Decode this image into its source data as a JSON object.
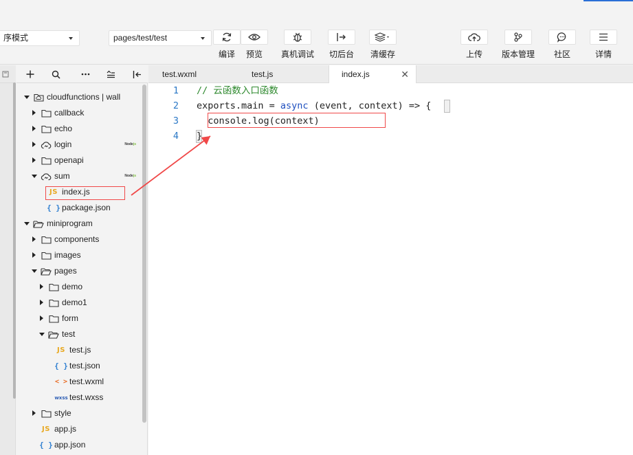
{
  "toolbar": {
    "mode_select": "序模式",
    "page_select": "pages/test/test",
    "buttons": [
      {
        "label": "编译",
        "icon": "refresh-icon"
      },
      {
        "label": "预览",
        "icon": "eye-icon"
      },
      {
        "label": "真机调试",
        "icon": "bug-icon"
      },
      {
        "label": "切后台",
        "icon": "switch-background-icon"
      },
      {
        "label": "清缓存",
        "icon": "layers-icon"
      },
      {
        "label": "上传",
        "icon": "cloud-upload-icon"
      },
      {
        "label": "版本管理",
        "icon": "branch-icon"
      },
      {
        "label": "社区",
        "icon": "chat-icon"
      },
      {
        "label": "详情",
        "icon": "menu-icon"
      }
    ]
  },
  "tree": {
    "items": [
      {
        "name": "cloudfunctions | wall",
        "type": "cloud-folder",
        "expanded": true
      },
      {
        "name": "callback",
        "type": "folder"
      },
      {
        "name": "echo",
        "type": "folder"
      },
      {
        "name": "login",
        "type": "cloud-function",
        "badge": "Nodejs"
      },
      {
        "name": "openapi",
        "type": "folder"
      },
      {
        "name": "sum",
        "type": "cloud-function",
        "badge": "Nodejs",
        "expanded": true
      },
      {
        "name": "index.js",
        "type": "js",
        "selected": true
      },
      {
        "name": "package.json",
        "type": "json"
      },
      {
        "name": "miniprogram",
        "type": "folder-open",
        "expanded": true
      },
      {
        "name": "components",
        "type": "folder"
      },
      {
        "name": "images",
        "type": "folder"
      },
      {
        "name": "pages",
        "type": "folder-open",
        "expanded": true
      },
      {
        "name": "demo",
        "type": "folder"
      },
      {
        "name": "demo1",
        "type": "folder"
      },
      {
        "name": "form",
        "type": "folder"
      },
      {
        "name": "test",
        "type": "folder-open",
        "expanded": true
      },
      {
        "name": "test.js",
        "type": "js"
      },
      {
        "name": "test.json",
        "type": "json"
      },
      {
        "name": "test.wxml",
        "type": "wxml"
      },
      {
        "name": "test.wxss",
        "type": "wxss"
      },
      {
        "name": "style",
        "type": "folder"
      },
      {
        "name": "app.js",
        "type": "js"
      },
      {
        "name": "app.json",
        "type": "json"
      }
    ],
    "icon_text": {
      "js": "JS",
      "json": "{ }",
      "wxml": "< >",
      "wxss": "wxss"
    }
  },
  "tabs": [
    {
      "label": "test.wxml"
    },
    {
      "label": "test.js"
    },
    {
      "label": "index.js",
      "active": true,
      "close": "✕"
    }
  ],
  "editor": {
    "line_numbers": [
      "1",
      "2",
      "3",
      "4"
    ],
    "line1": "// 云函数入口函数",
    "line2_a": "exports.main = ",
    "line2_kw": "async",
    "line2_b": " (event, context) => {",
    "line3": "  console.log(context)",
    "line4": "}"
  },
  "colors": {
    "annotation": "#f04848",
    "comment": "#2f8a2f",
    "keyword": "#1f4fbf",
    "line_number": "#2b78c6"
  }
}
